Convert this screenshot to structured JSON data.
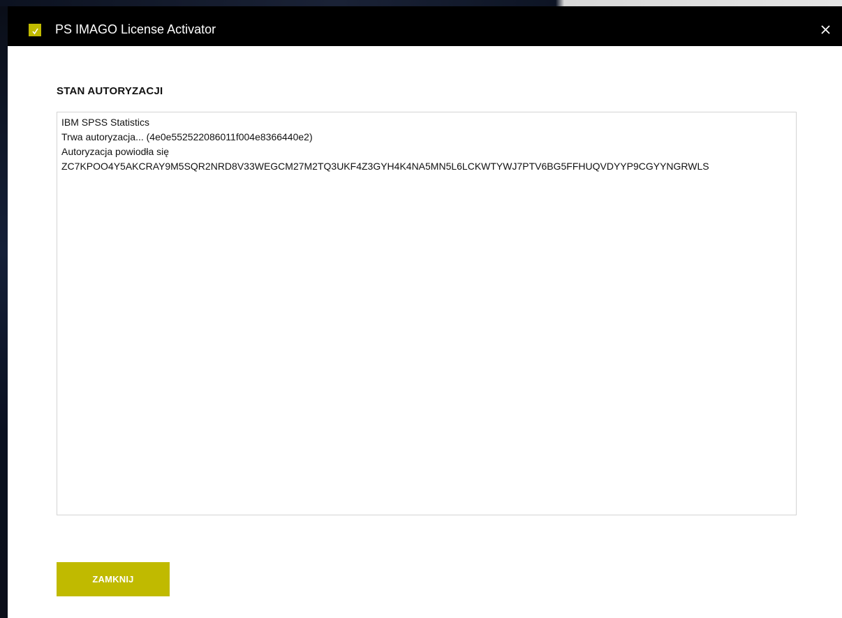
{
  "window": {
    "title": "PS IMAGO License Activator",
    "icon": "ps-imago-logo-icon",
    "accent_color": "#c0ba00",
    "close_icon": "close-icon"
  },
  "status_section": {
    "title": "STAN AUTORYZACJI",
    "lines": [
      "IBM SPSS Statistics",
      "Trwa autoryzacja... (4e0e552522086011f004e8366440e2)",
      "Autoryzacja powiodła się",
      "ZC7KPOO4Y5AKCRAY9M5SQR2NRD8V33WEGCM27M2TQ3UKF4Z3GYH4K4NA5MN5L6LCKWTYWJ7PTV6BG5FFHUQVDYYP9CGYYNGRWLS"
    ]
  },
  "actions": {
    "close_label": "ZAMKNIJ"
  }
}
